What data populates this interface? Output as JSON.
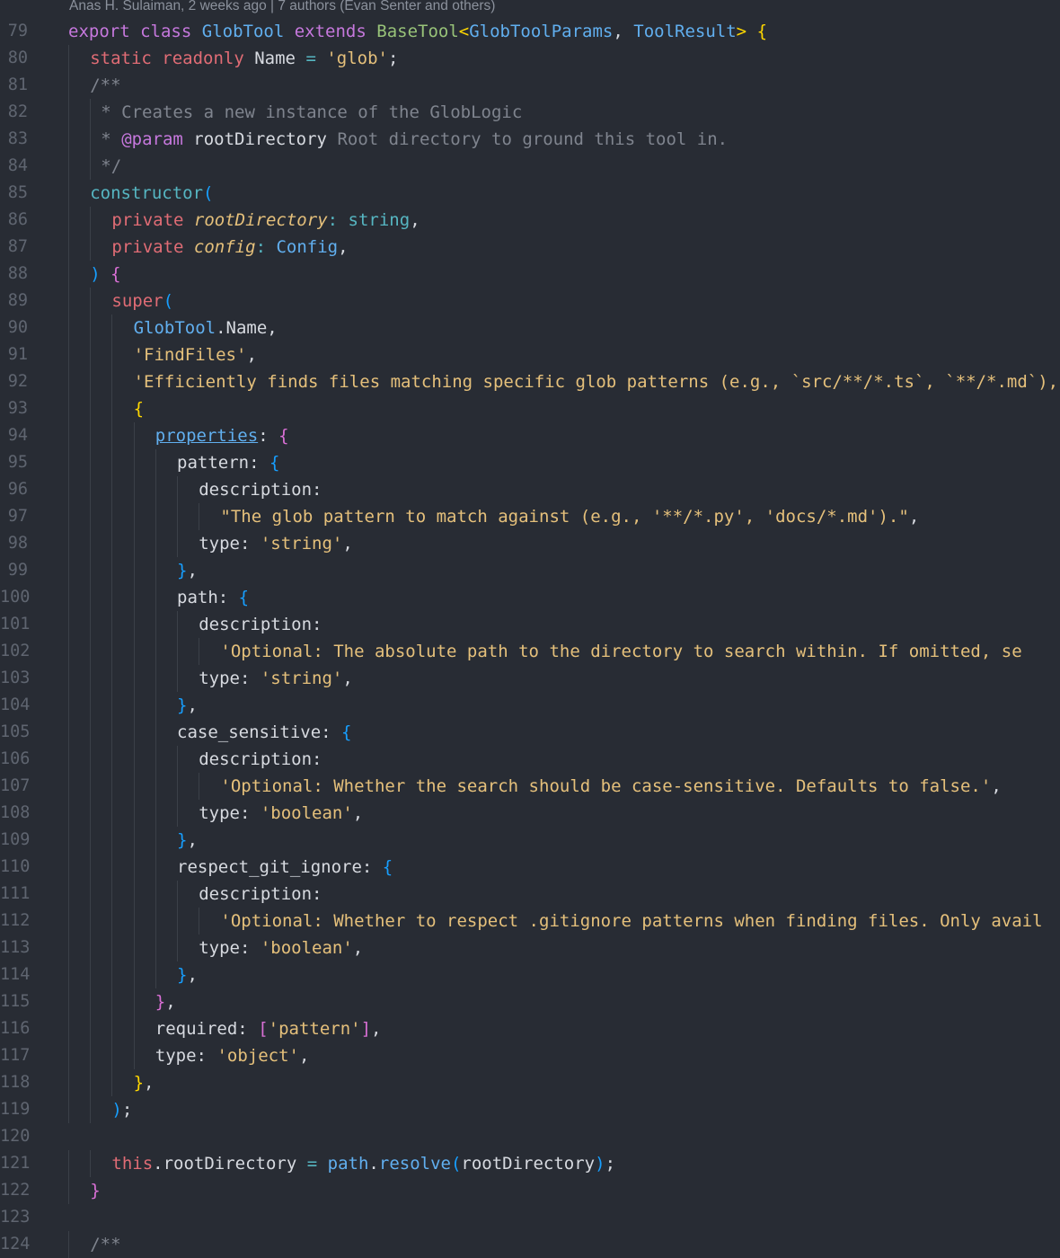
{
  "codelens": "Anas H. Sulaiman, 2 weeks ago | 7 authors (Evan Senter and others)",
  "lines": [
    {
      "n": "79",
      "indent": 0,
      "tokens": [
        [
          "kw",
          "export"
        ],
        [
          "p",
          " "
        ],
        [
          "kw",
          "class"
        ],
        [
          "p",
          " "
        ],
        [
          "cl",
          "GlobTool"
        ],
        [
          "p",
          " "
        ],
        [
          "kw",
          "extends"
        ],
        [
          "p",
          " "
        ],
        [
          "bc",
          "BaseTool"
        ],
        [
          "b1",
          "<"
        ],
        [
          "cl",
          "GlobToolParams"
        ],
        [
          "p",
          ", "
        ],
        [
          "cl",
          "ToolResult"
        ],
        [
          "b1",
          ">"
        ],
        [
          "p",
          " "
        ],
        [
          "b1",
          "{"
        ]
      ]
    },
    {
      "n": "80",
      "indent": 2,
      "tokens": [
        [
          "st",
          "static"
        ],
        [
          "p",
          " "
        ],
        [
          "st",
          "readonly"
        ],
        [
          "p",
          " Name "
        ],
        [
          "op",
          "="
        ],
        [
          "p",
          " "
        ],
        [
          "s",
          "'glob'"
        ],
        [
          "p",
          ";"
        ]
      ]
    },
    {
      "n": "81",
      "indent": 2,
      "tokens": [
        [
          "cm",
          "/**"
        ]
      ]
    },
    {
      "n": "82",
      "indent": 3,
      "tokens": [
        [
          "cm",
          "* Creates a new instance of the GlobLogic"
        ]
      ]
    },
    {
      "n": "83",
      "indent": 3,
      "tokens": [
        [
          "cm",
          "* "
        ],
        [
          "cp",
          "@param"
        ],
        [
          "p",
          " "
        ],
        [
          "cp2",
          "rootDirectory"
        ],
        [
          "cm",
          " Root directory to ground this tool in."
        ]
      ]
    },
    {
      "n": "84",
      "indent": 3,
      "tokens": [
        [
          "cm",
          "*/"
        ]
      ]
    },
    {
      "n": "85",
      "indent": 2,
      "tokens": [
        [
          "ty",
          "constructor"
        ],
        [
          "b3",
          "("
        ]
      ]
    },
    {
      "n": "86",
      "indent": 4,
      "tokens": [
        [
          "st",
          "private"
        ],
        [
          "p",
          " "
        ],
        [
          "pm",
          "rootDirectory"
        ],
        [
          "op",
          ":"
        ],
        [
          "p",
          " "
        ],
        [
          "ty",
          "string"
        ],
        [
          "p",
          ","
        ]
      ]
    },
    {
      "n": "87",
      "indent": 4,
      "tokens": [
        [
          "st",
          "private"
        ],
        [
          "p",
          " "
        ],
        [
          "pm",
          "config"
        ],
        [
          "op",
          ":"
        ],
        [
          "p",
          " "
        ],
        [
          "cl",
          "Config"
        ],
        [
          "p",
          ","
        ]
      ]
    },
    {
      "n": "88",
      "indent": 2,
      "tokens": [
        [
          "b3",
          ")"
        ],
        [
          "p",
          " "
        ],
        [
          "b2",
          "{"
        ]
      ]
    },
    {
      "n": "89",
      "indent": 4,
      "tokens": [
        [
          "st",
          "super"
        ],
        [
          "b3",
          "("
        ]
      ]
    },
    {
      "n": "90",
      "indent": 6,
      "tokens": [
        [
          "cl",
          "GlobTool"
        ],
        [
          "p",
          ".Name,"
        ]
      ]
    },
    {
      "n": "91",
      "indent": 6,
      "tokens": [
        [
          "s",
          "'FindFiles'"
        ],
        [
          "p",
          ","
        ]
      ]
    },
    {
      "n": "92",
      "indent": 6,
      "tokens": [
        [
          "s",
          "'Efficiently finds files matching specific glob patterns (e.g., `src/**/*.ts`, `**/*.md`), r"
        ]
      ]
    },
    {
      "n": "93",
      "indent": 6,
      "tokens": [
        [
          "b1",
          "{"
        ]
      ]
    },
    {
      "n": "94",
      "indent": 8,
      "tokens": [
        [
          "lnk",
          "properties"
        ],
        [
          "p",
          ": "
        ],
        [
          "b2",
          "{"
        ]
      ]
    },
    {
      "n": "95",
      "indent": 10,
      "tokens": [
        [
          "p",
          "pattern: "
        ],
        [
          "b3",
          "{"
        ]
      ]
    },
    {
      "n": "96",
      "indent": 12,
      "tokens": [
        [
          "p",
          "description:"
        ]
      ]
    },
    {
      "n": "97",
      "indent": 14,
      "tokens": [
        [
          "s",
          "\"The glob pattern to match against (e.g., '**/*.py', 'docs/*.md').\""
        ],
        [
          "p",
          ","
        ]
      ]
    },
    {
      "n": "98",
      "indent": 12,
      "tokens": [
        [
          "p",
          "type: "
        ],
        [
          "s",
          "'string'"
        ],
        [
          "p",
          ","
        ]
      ]
    },
    {
      "n": "99",
      "indent": 10,
      "tokens": [
        [
          "b3",
          "}"
        ],
        [
          "p",
          ","
        ]
      ]
    },
    {
      "n": "100",
      "indent": 10,
      "tokens": [
        [
          "p",
          "path: "
        ],
        [
          "b3",
          "{"
        ]
      ]
    },
    {
      "n": "101",
      "indent": 12,
      "tokens": [
        [
          "p",
          "description:"
        ]
      ]
    },
    {
      "n": "102",
      "indent": 14,
      "tokens": [
        [
          "s",
          "'Optional: The absolute path to the directory to search within. If omitted, se"
        ]
      ]
    },
    {
      "n": "103",
      "indent": 12,
      "tokens": [
        [
          "p",
          "type: "
        ],
        [
          "s",
          "'string'"
        ],
        [
          "p",
          ","
        ]
      ]
    },
    {
      "n": "104",
      "indent": 10,
      "tokens": [
        [
          "b3",
          "}"
        ],
        [
          "p",
          ","
        ]
      ]
    },
    {
      "n": "105",
      "indent": 10,
      "tokens": [
        [
          "p",
          "case_sensitive: "
        ],
        [
          "b3",
          "{"
        ]
      ]
    },
    {
      "n": "106",
      "indent": 12,
      "tokens": [
        [
          "p",
          "description:"
        ]
      ]
    },
    {
      "n": "107",
      "indent": 14,
      "tokens": [
        [
          "s",
          "'Optional: Whether the search should be case-sensitive. Defaults to false.'"
        ],
        [
          "p",
          ","
        ]
      ]
    },
    {
      "n": "108",
      "indent": 12,
      "tokens": [
        [
          "p",
          "type: "
        ],
        [
          "s",
          "'boolean'"
        ],
        [
          "p",
          ","
        ]
      ]
    },
    {
      "n": "109",
      "indent": 10,
      "tokens": [
        [
          "b3",
          "}"
        ],
        [
          "p",
          ","
        ]
      ]
    },
    {
      "n": "110",
      "indent": 10,
      "tokens": [
        [
          "p",
          "respect_git_ignore: "
        ],
        [
          "b3",
          "{"
        ]
      ]
    },
    {
      "n": "111",
      "indent": 12,
      "tokens": [
        [
          "p",
          "description:"
        ]
      ]
    },
    {
      "n": "112",
      "indent": 14,
      "tokens": [
        [
          "s",
          "'Optional: Whether to respect .gitignore patterns when finding files. Only avail"
        ]
      ]
    },
    {
      "n": "113",
      "indent": 12,
      "tokens": [
        [
          "p",
          "type: "
        ],
        [
          "s",
          "'boolean'"
        ],
        [
          "p",
          ","
        ]
      ]
    },
    {
      "n": "114",
      "indent": 10,
      "tokens": [
        [
          "b3",
          "}"
        ],
        [
          "p",
          ","
        ]
      ]
    },
    {
      "n": "115",
      "indent": 8,
      "tokens": [
        [
          "b2",
          "}"
        ],
        [
          "p",
          ","
        ]
      ]
    },
    {
      "n": "116",
      "indent": 8,
      "tokens": [
        [
          "p",
          "required: "
        ],
        [
          "b2",
          "["
        ],
        [
          "s",
          "'pattern'"
        ],
        [
          "b2",
          "]"
        ],
        [
          "p",
          ","
        ]
      ]
    },
    {
      "n": "117",
      "indent": 8,
      "tokens": [
        [
          "p",
          "type: "
        ],
        [
          "s",
          "'object'"
        ],
        [
          "p",
          ","
        ]
      ]
    },
    {
      "n": "118",
      "indent": 6,
      "tokens": [
        [
          "b1",
          "}"
        ],
        [
          "p",
          ","
        ]
      ]
    },
    {
      "n": "119",
      "indent": 4,
      "tokens": [
        [
          "b3",
          ")"
        ],
        [
          "p",
          ";"
        ]
      ]
    },
    {
      "n": "120",
      "indent": 0,
      "tokens": []
    },
    {
      "n": "121",
      "indent": 4,
      "tokens": [
        [
          "th",
          "this"
        ],
        [
          "p",
          ".rootDirectory "
        ],
        [
          "op",
          "="
        ],
        [
          "p",
          " "
        ],
        [
          "cl",
          "path"
        ],
        [
          "p",
          "."
        ],
        [
          "cl",
          "resolve"
        ],
        [
          "b3",
          "("
        ],
        [
          "p",
          "rootDirectory"
        ],
        [
          "b3",
          ")"
        ],
        [
          "p",
          ";"
        ]
      ]
    },
    {
      "n": "122",
      "indent": 2,
      "tokens": [
        [
          "b2",
          "}"
        ]
      ]
    },
    {
      "n": "123",
      "indent": 0,
      "tokens": []
    },
    {
      "n": "124",
      "indent": 2,
      "tokens": [
        [
          "cm",
          "/**"
        ]
      ]
    }
  ]
}
